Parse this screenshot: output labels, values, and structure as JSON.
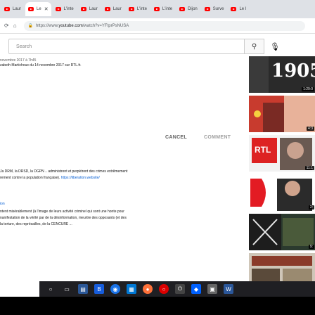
{
  "tabs": [
    {
      "label": "Laur",
      "active": false
    },
    {
      "label": "Le",
      "active": true
    },
    {
      "label": "L'inte",
      "active": false
    },
    {
      "label": "Laur",
      "active": false
    },
    {
      "label": "Laur",
      "active": false
    },
    {
      "label": "L'inte",
      "active": false
    },
    {
      "label": "L'inte",
      "active": false
    },
    {
      "label": "Dijon",
      "active": false
    },
    {
      "label": "Surve",
      "active": false
    },
    {
      "label": "Le l",
      "active": false
    }
  ],
  "address": {
    "scheme": "https://www.",
    "host": "youtube.com",
    "path": "/watch?v=YFtprPsNUSA"
  },
  "search": {
    "placeholder": "Search"
  },
  "content": {
    "line_top_cut": "novembre 2017 à 7h45",
    "line_source": "zabeth Martichoux du 14 novembre 2017 sur RTL.fr.",
    "cancel_label": "CANCEL",
    "comment_label": "COMMENT",
    "c1_l1": "Ja DRM, la DRSD, la DGPN .. administrent et perpètrent des crimes extrêmement",
    "c1_l2_text": "rement contre la population française). ",
    "c1_l2_link": "https://liberation.website/",
    "c2_name": "ion",
    "c2_l1": "ntent misérablement (à l'image de leurs activité criminel qui sont une honte pour",
    "c2_l2": "nanifestation de la vérité par de la désinformation, meurtre des opposants (et des",
    "c2_l3": "la torture, des représailles, de la CENCURE ..."
  },
  "sidebar": [
    {
      "badge": "1:29:0",
      "caption": "1905"
    },
    {
      "badge": "4:3",
      "caption": ""
    },
    {
      "badge": "11:1",
      "caption": "RTL"
    },
    {
      "badge": "2:",
      "caption": ""
    },
    {
      "badge": "9:",
      "caption": ""
    },
    {
      "badge": "1:",
      "caption": ""
    }
  ],
  "taskbar": [
    "start-icon",
    "search-icon",
    "task-view-icon",
    "file-explorer-icon",
    "bitwarden-icon",
    "chrome-icon",
    "store-icon",
    "firefox-icon",
    "opera-icon",
    "power-icon",
    "dropbox-icon",
    "app-icon",
    "word-icon"
  ]
}
